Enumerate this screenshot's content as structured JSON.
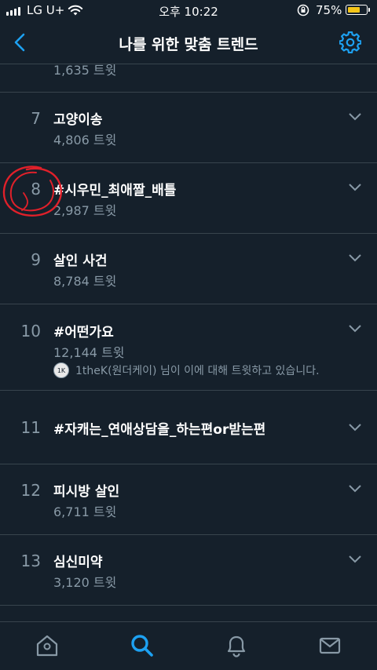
{
  "status_bar": {
    "carrier": "LG U+",
    "time": "오후 10:22",
    "battery_percent": "75%",
    "battery_level": 0.75
  },
  "header": {
    "title": "나를 위한 맞춤 트렌드",
    "back_icon": "chevron-left-icon",
    "settings_icon": "gear-icon"
  },
  "partial_top_count": "1,635 트윗",
  "trends": [
    {
      "rank": "7",
      "name": "고양이송",
      "count": "4,806 트윗"
    },
    {
      "rank": "8",
      "name": "#시우민_최애짤_배틀",
      "count": "2,987 트윗"
    },
    {
      "rank": "9",
      "name": "살인 사건",
      "count": "8,784 트윗"
    },
    {
      "rank": "10",
      "name": "#어떤가요",
      "count": "12,144 트윗",
      "context": "1theK(원더케이) 님이 이에 대해 트윗하고 있습니다."
    },
    {
      "rank": "11",
      "name": "#자캐는_연애상담을_하는편or받는편",
      "count": ""
    },
    {
      "rank": "12",
      "name": "피시방 살인",
      "count": "6,711 트윗"
    },
    {
      "rank": "13",
      "name": "심신미약",
      "count": "3,120 트윗"
    }
  ],
  "tab_bar": {
    "items": [
      "home-icon",
      "search-icon",
      "bell-icon",
      "mail-icon"
    ],
    "active": "search-icon"
  },
  "colors": {
    "background": "#15202b",
    "accent": "#1da1f2",
    "muted": "#8899a6",
    "divider": "#38444d",
    "annotation": "#e0202a"
  }
}
